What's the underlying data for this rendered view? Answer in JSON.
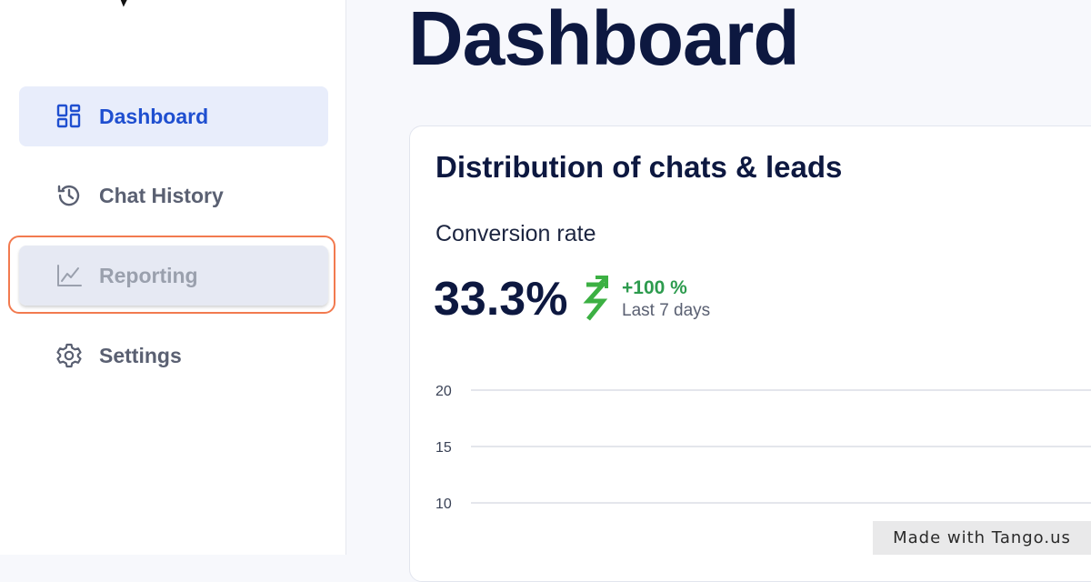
{
  "sidebar": {
    "items": [
      {
        "label": "Dashboard",
        "icon": "dashboard-grid-icon",
        "state": "active"
      },
      {
        "label": "Chat History",
        "icon": "history-clock-icon",
        "state": "default"
      },
      {
        "label": "Reporting",
        "icon": "line-chart-icon",
        "state": "highlighted"
      },
      {
        "label": "Settings",
        "icon": "gear-icon",
        "state": "default"
      }
    ]
  },
  "main": {
    "title": "Dashboard",
    "card": {
      "title": "Distribution of chats & leads",
      "metric_label": "Conversion rate",
      "metric_value": "33.3%",
      "delta": "+100 %",
      "period": "Last 7 days",
      "trend_icon": "trend-up-arrow-icon"
    }
  },
  "chart_data": {
    "type": "line",
    "y_ticks": [
      "20",
      "15",
      "10"
    ],
    "grid": true
  },
  "colors": {
    "accent": "#1f4fd0",
    "highlight_ring": "#f27a4f",
    "positive": "#2d9b4e",
    "title": "#0d1840"
  },
  "watermark": "Made with Tango.us"
}
